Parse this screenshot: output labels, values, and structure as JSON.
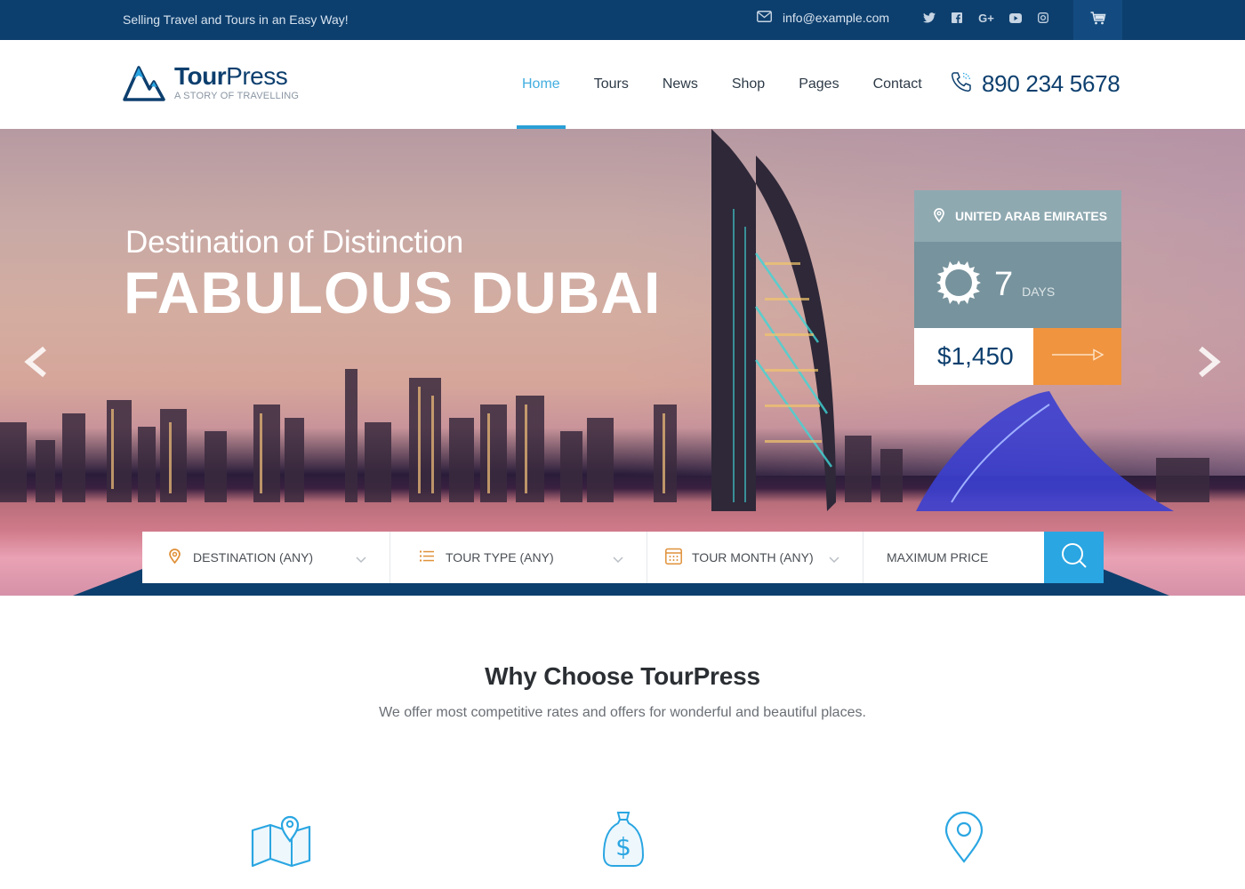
{
  "topbar": {
    "tagline": "Selling Travel and Tours in an Easy Way!",
    "email": "info@example.com",
    "social": [
      {
        "name": "twitter",
        "glyph": "t"
      },
      {
        "name": "facebook",
        "glyph": "f"
      },
      {
        "name": "google-plus",
        "glyph": "G+"
      },
      {
        "name": "youtube",
        "glyph": "▶"
      },
      {
        "name": "instagram",
        "glyph": "◎"
      }
    ],
    "cart_icon": "cart-icon"
  },
  "header": {
    "logo": {
      "name_bold": "Tour",
      "name_light": "Press",
      "slogan": "A STORY OF TRAVELLING"
    },
    "nav": [
      {
        "label": "Home",
        "active": true
      },
      {
        "label": "Tours"
      },
      {
        "label": "News"
      },
      {
        "label": "Shop"
      },
      {
        "label": "Pages"
      },
      {
        "label": "Contact"
      }
    ],
    "phone": "890 234 5678"
  },
  "hero": {
    "subtitle": "Destination of Distinction",
    "title": "FABULOUS DUBAI",
    "card": {
      "location": "UNITED ARAB EMIRATES",
      "duration_value": "7",
      "duration_unit": "DAYS",
      "price": "$1,450"
    }
  },
  "search": {
    "destination": "DESTINATION (ANY)",
    "tour_type": "TOUR TYPE (ANY)",
    "tour_month": "TOUR MONTH (ANY)",
    "max_price_placeholder": "MAXIMUM PRICE"
  },
  "why": {
    "title": "Why Choose TourPress",
    "subtitle": "We offer most competitive rates and offers for wonderful and beautiful places.",
    "features": [
      {
        "icon": "map-icon"
      },
      {
        "icon": "money-bag-icon"
      },
      {
        "icon": "location-pin-icon"
      }
    ]
  },
  "colors": {
    "topbar": "#0d3f6e",
    "brand": "#0d3f6e",
    "accent": "#2aa6e2",
    "orange": "#f0943f",
    "card_top": "#8fa9b1",
    "card_mid": "#77939d"
  }
}
